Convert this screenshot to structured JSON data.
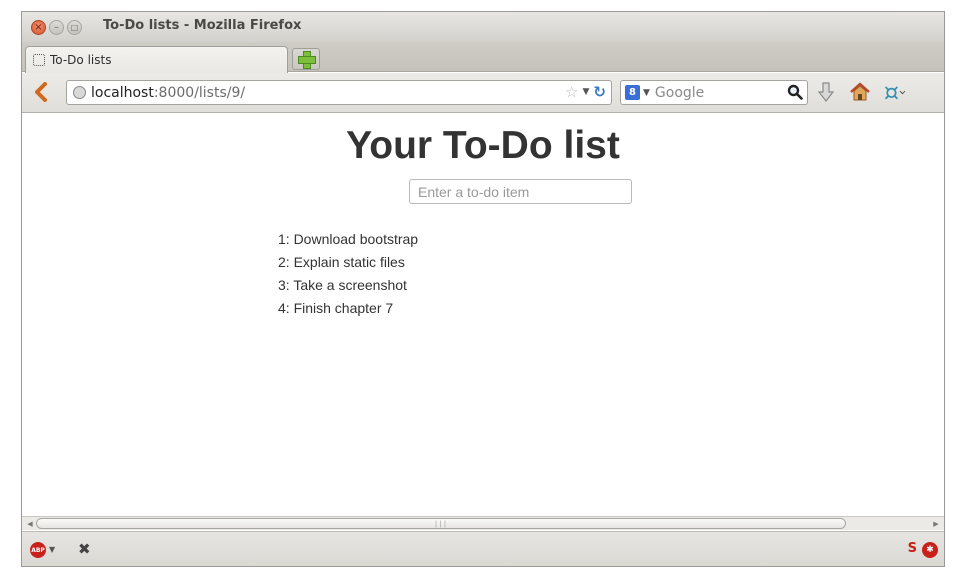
{
  "window": {
    "title": "To-Do lists - Mozilla Firefox"
  },
  "tabs": [
    {
      "label": "To-Do lists",
      "active": true
    }
  ],
  "navbar": {
    "url_host": "localhost",
    "url_rest": ":8000/lists/9/",
    "search_placeholder": "Google",
    "search_engine_icon": "google-icon"
  },
  "page": {
    "title": "Your To-Do list",
    "input_placeholder": "Enter a to-do item",
    "items": [
      "1: Download bootstrap",
      "2: Explain static files",
      "3: Take a screenshot",
      "4: Finish chapter 7"
    ]
  },
  "colors": {
    "page_text": "#333333",
    "close_button": "#d9532b",
    "link_blue": "#3b6fd6"
  }
}
